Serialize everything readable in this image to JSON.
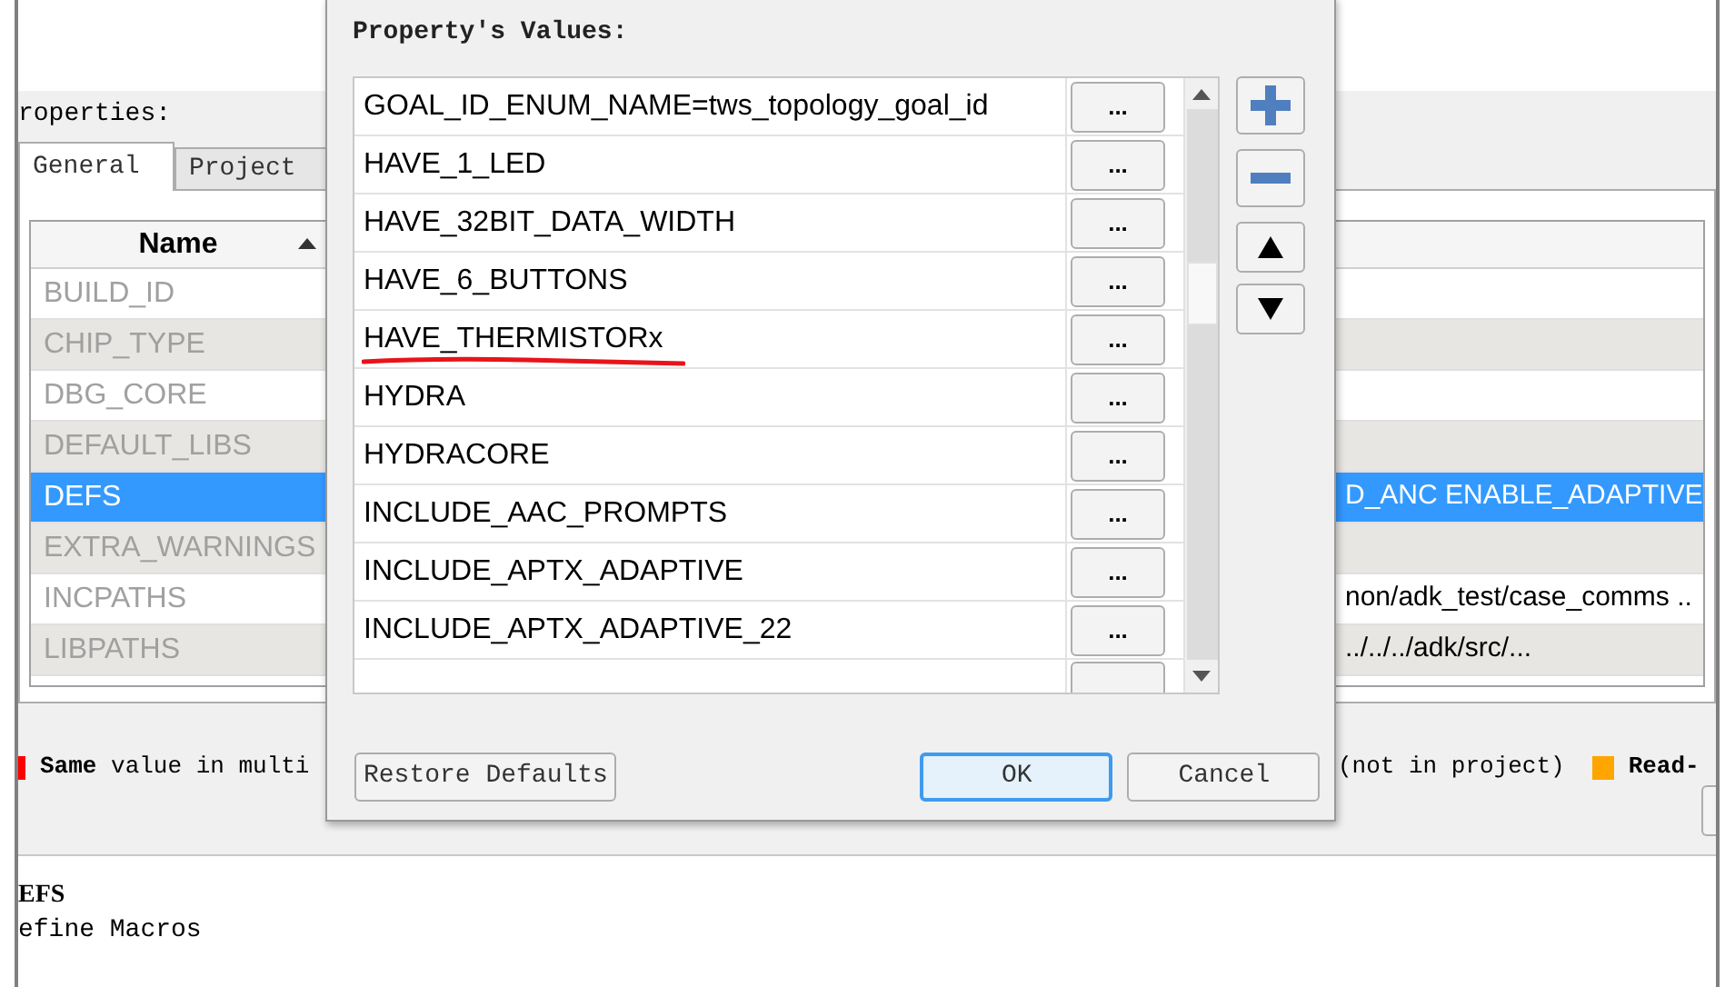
{
  "properties_label": "roperties:",
  "tabs": [
    {
      "label": "General",
      "selected": true
    },
    {
      "label": "Project",
      "selected": false
    }
  ],
  "table": {
    "columns": [
      "Name"
    ],
    "rows": [
      {
        "name": "BUILD_ID",
        "selected": false
      },
      {
        "name": "CHIP_TYPE",
        "selected": false
      },
      {
        "name": "DBG_CORE",
        "selected": false
      },
      {
        "name": "DEFAULT_LIBS",
        "selected": false
      },
      {
        "name": "DEFS",
        "value": "D_ANC ENABLE_ADAPTIVE",
        "selected": true
      },
      {
        "name": "EXTRA_WARNINGS",
        "selected": false
      },
      {
        "name": "INCPATHS",
        "value": "non/adk_test/case_comms ..",
        "selected": false
      },
      {
        "name": "LIBPATHS",
        "value": "../../../adk/src/...",
        "selected": false
      }
    ]
  },
  "legend": [
    {
      "color": "#ff0000",
      "text": "**Same** value in multi"
    },
    {
      "text": "(not in project)"
    },
    {
      "color": "#ffa500",
      "text": "**Read-**"
    }
  ],
  "description": {
    "title": "EFS",
    "text": "efine Macros"
  },
  "dialog": {
    "heading": "Property's Values:",
    "values": [
      {
        "text": "GOAL_ID_ENUM_NAME=tws_topology_goal_id",
        "button": "...",
        "underlined": false
      },
      {
        "text": "HAVE_1_LED",
        "button": "...",
        "underlined": false
      },
      {
        "text": "HAVE_32BIT_DATA_WIDTH",
        "button": "...",
        "underlined": false
      },
      {
        "text": "HAVE_6_BUTTONS",
        "button": "...",
        "underlined": false
      },
      {
        "text": "HAVE_THERMISTORx",
        "button": "...",
        "underlined": true
      },
      {
        "text": "HYDRA",
        "button": "...",
        "underlined": false
      },
      {
        "text": "HYDRACORE",
        "button": "...",
        "underlined": false
      },
      {
        "text": "INCLUDE_AAC_PROMPTS",
        "button": "...",
        "underlined": false
      },
      {
        "text": "INCLUDE_APTX_ADAPTIVE",
        "button": "...",
        "underlined": false
      },
      {
        "text": "INCLUDE_APTX_ADAPTIVE_22",
        "button": "...",
        "underlined": false
      }
    ],
    "restore_button": "Restore Defaults",
    "ok_button": "OK",
    "cancel_button": "Cancel"
  }
}
